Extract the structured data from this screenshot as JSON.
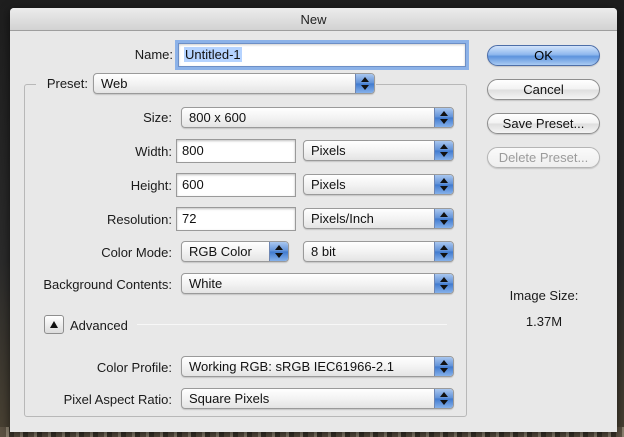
{
  "dialog": {
    "title": "New"
  },
  "fields": {
    "name_label": "Name:",
    "name_value": "Untitled-1",
    "preset_label": "Preset:",
    "preset_value": "Web",
    "size_label": "Size:",
    "size_value": "800 x 600",
    "width_label": "Width:",
    "width_value": "800",
    "width_unit": "Pixels",
    "height_label": "Height:",
    "height_value": "600",
    "height_unit": "Pixels",
    "resolution_label": "Resolution:",
    "resolution_value": "72",
    "resolution_unit": "Pixels/Inch",
    "color_mode_label": "Color Mode:",
    "color_mode_value": "RGB Color",
    "bit_depth_value": "8 bit",
    "background_label": "Background Contents:",
    "background_value": "White",
    "advanced_label": "Advanced",
    "color_profile_label": "Color Profile:",
    "color_profile_value": "Working RGB:  sRGB IEC61966-2.1",
    "aspect_label": "Pixel Aspect Ratio:",
    "aspect_value": "Square Pixels"
  },
  "buttons": {
    "ok": "OK",
    "cancel": "Cancel",
    "save_preset": "Save Preset...",
    "delete_preset": "Delete Preset..."
  },
  "info": {
    "image_size_label": "Image Size:",
    "image_size_value": "1.37M"
  },
  "colors": {
    "accent": "#5d93dd",
    "dialog_bg": "#e8e8e8"
  }
}
